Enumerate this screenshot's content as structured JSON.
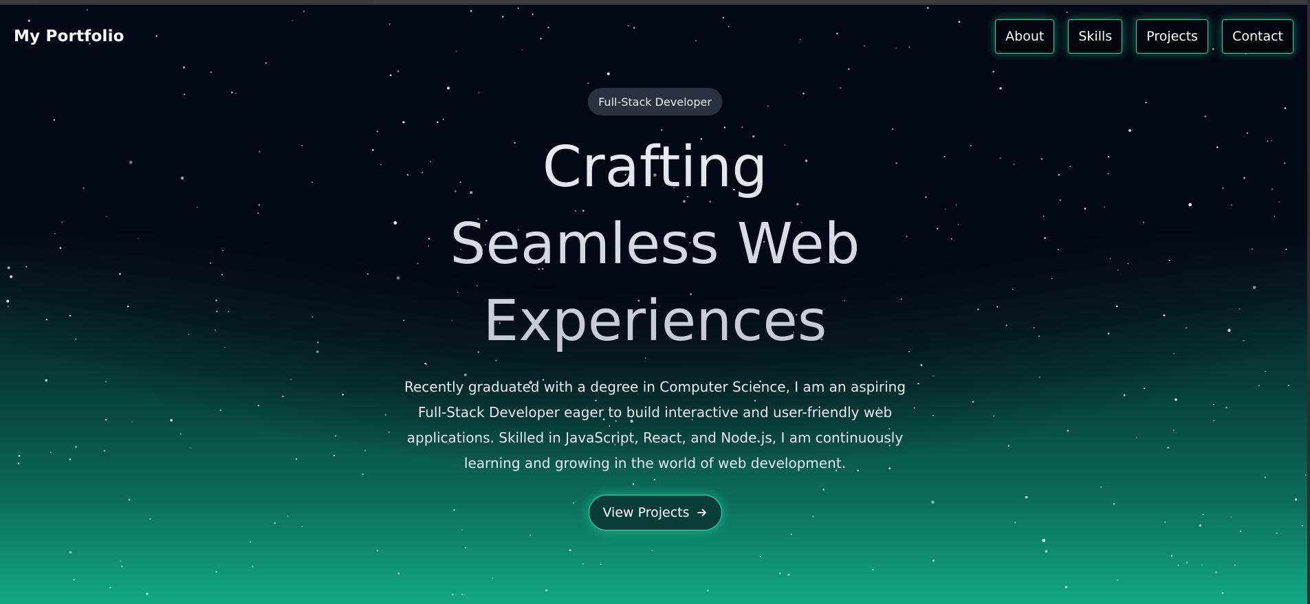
{
  "nav": {
    "logo": "My Portfolio",
    "links": [
      "About",
      "Skills",
      "Projects",
      "Contact"
    ]
  },
  "hero": {
    "badge": "Full-Stack Developer",
    "headline_lines": [
      "Crafting",
      "Seamless Web",
      "Experiences"
    ],
    "description": "Recently graduated with a degree in Computer Science, I am an aspiring Full-Stack Developer eager to build interactive and user-friendly web applications. Skilled in JavaScript, React, and Node.js, I am continuously learning and growing in the world of web development.",
    "cta_label": "View Projects",
    "cta_icon": "arrow-right-icon"
  },
  "colors": {
    "accent": "#25d7a3",
    "background_top": "#050816",
    "background_bottom": "#12a884",
    "badge_bg": "#2a3140"
  }
}
